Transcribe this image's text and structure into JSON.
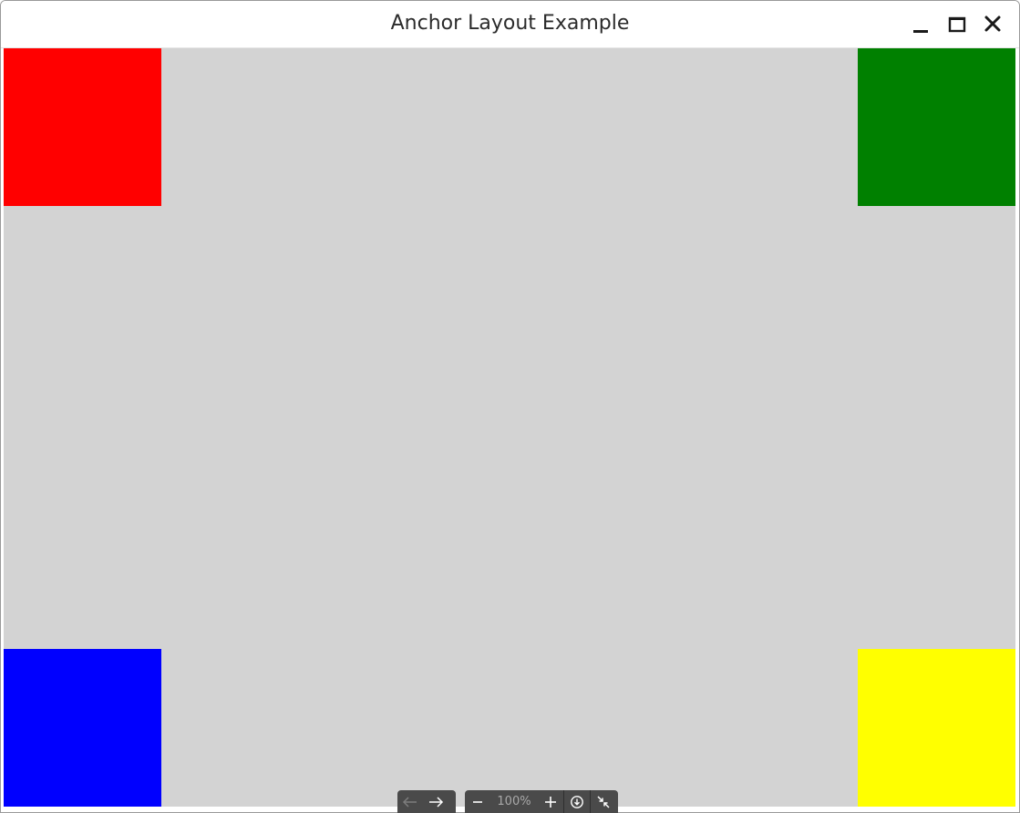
{
  "window": {
    "title": "Anchor Layout Example",
    "controls": {
      "minimize": "minimize-icon",
      "maximize": "maximize-icon",
      "close": "close-icon"
    }
  },
  "layout": {
    "background_color": "#d3d3d3",
    "squares": [
      {
        "anchor": "top-left",
        "color": "#ff0000"
      },
      {
        "anchor": "top-right",
        "color": "#008000"
      },
      {
        "anchor": "bottom-left",
        "color": "#0000ff"
      },
      {
        "anchor": "bottom-right",
        "color": "#ffff00"
      }
    ]
  },
  "viewer_toolbar": {
    "back_icon": "arrow-left-icon",
    "forward_icon": "arrow-right-icon",
    "zoom_out_icon": "minus-icon",
    "zoom_level": "100%",
    "zoom_in_icon": "plus-icon",
    "download_icon": "download-icon",
    "collapse_icon": "collapse-icon"
  }
}
